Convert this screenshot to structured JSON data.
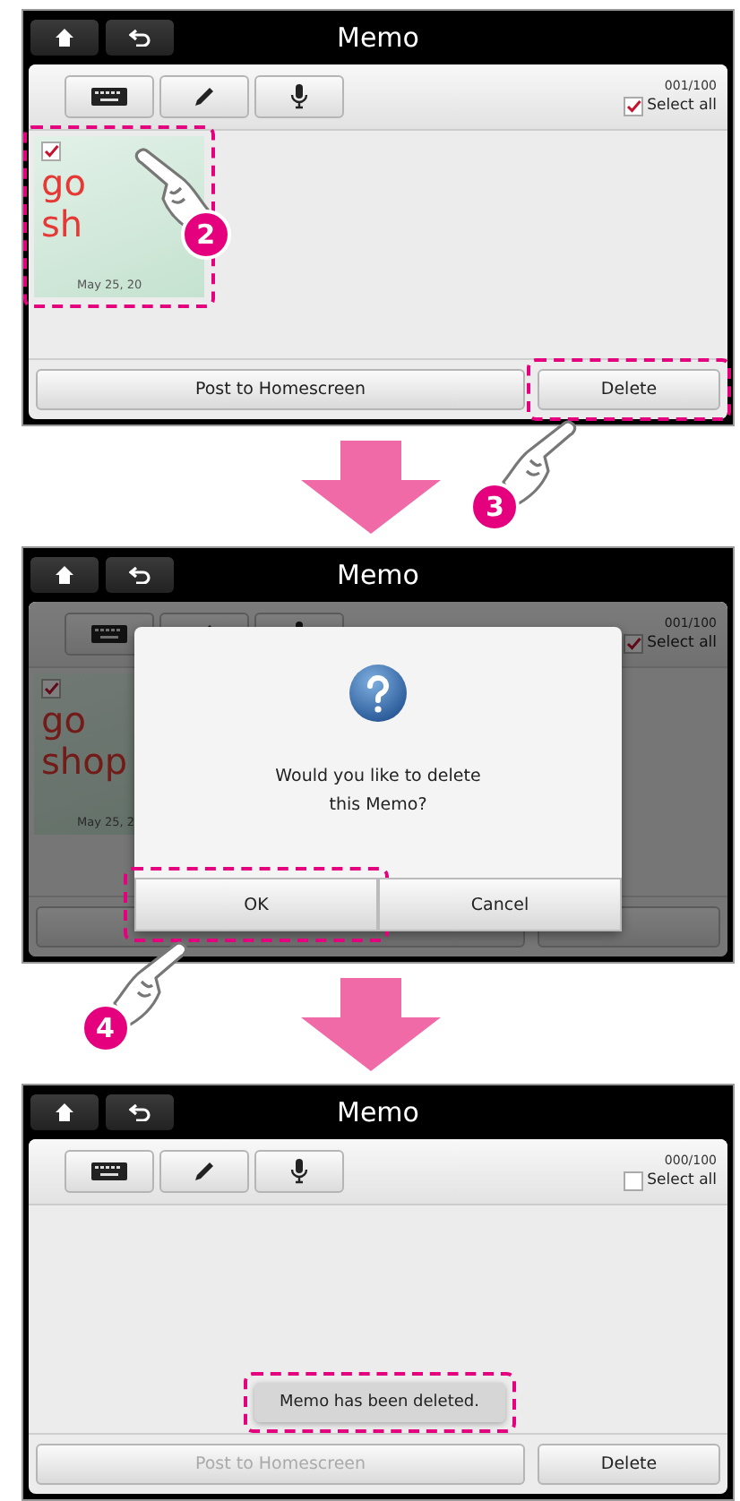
{
  "steps": [
    {
      "screen": {
        "title": "Memo",
        "counter": "001/100",
        "select_all": {
          "label": "Select all",
          "checked": true
        },
        "dimmed": false,
        "memos": [
          {
            "lines": [
              "go",
              "sh"
            ],
            "date": "May 25, 20",
            "checked": true,
            "highlighted": true,
            "callout": "2"
          }
        ],
        "buttons": [
          {
            "label": "Post to Homescreen",
            "disabled": false,
            "highlighted": false
          },
          {
            "label": "Delete",
            "disabled": false,
            "highlighted": true,
            "callout": "3"
          }
        ]
      }
    },
    {
      "screen": {
        "title": "Memo",
        "counter": "001/100",
        "select_all": {
          "label": "Select all",
          "checked": true
        },
        "dimmed": true,
        "memos": [
          {
            "lines": [
              "go",
              "shop"
            ],
            "date": "May 25, 2",
            "checked": true,
            "highlighted": false
          }
        ],
        "buttons": [
          {
            "highlighted": false
          },
          {
            "highlighted": false
          }
        ],
        "dialog": {
          "message": "Would you like to delete this Memo?",
          "buttons": [
            {
              "label": "OK",
              "highlighted": true,
              "callout": "4"
            },
            {
              "label": "Cancel",
              "highlighted": false
            }
          ]
        }
      }
    },
    {
      "screen": {
        "title": "Memo",
        "counter": "000/100",
        "select_all": {
          "label": "Select all",
          "checked": false
        },
        "dimmed": false,
        "buttons": [
          {
            "label": "Post to Homescreen",
            "disabled": true,
            "highlighted": false
          },
          {
            "label": "Delete",
            "disabled": false,
            "highlighted": false
          }
        ],
        "toast": {
          "text": "Memo has been deleted.",
          "highlighted": true
        }
      }
    }
  ]
}
